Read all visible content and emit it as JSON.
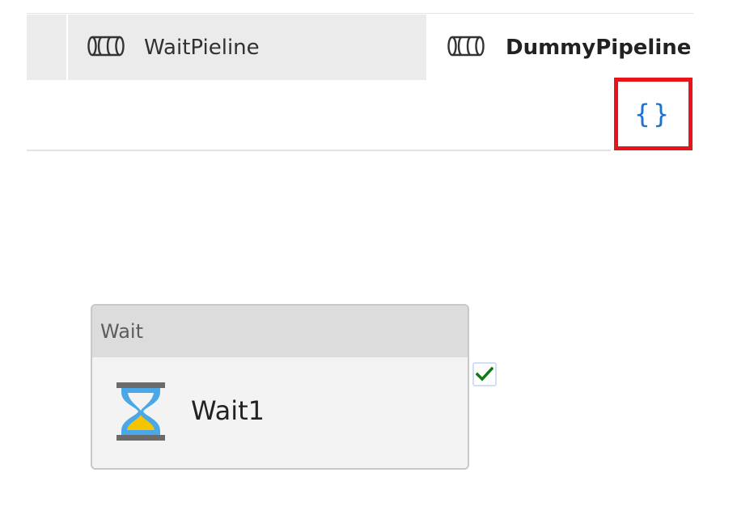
{
  "tabs": [
    {
      "label": "WaitPieline",
      "icon": "pipeline-icon",
      "active": false
    },
    {
      "label": "DummyPipeline",
      "icon": "pipeline-icon",
      "active": true
    }
  ],
  "toolbar": {
    "code_button_label": "{}",
    "code_button_icon": "code-braces-icon",
    "highlight_color": "#e8141c",
    "brace_color": "#1a73d0"
  },
  "activity": {
    "type_label": "Wait",
    "name": "Wait1",
    "icon": "hourglass-icon",
    "status": "succeeded",
    "status_icon": "check-icon",
    "status_color": "#107c10"
  }
}
